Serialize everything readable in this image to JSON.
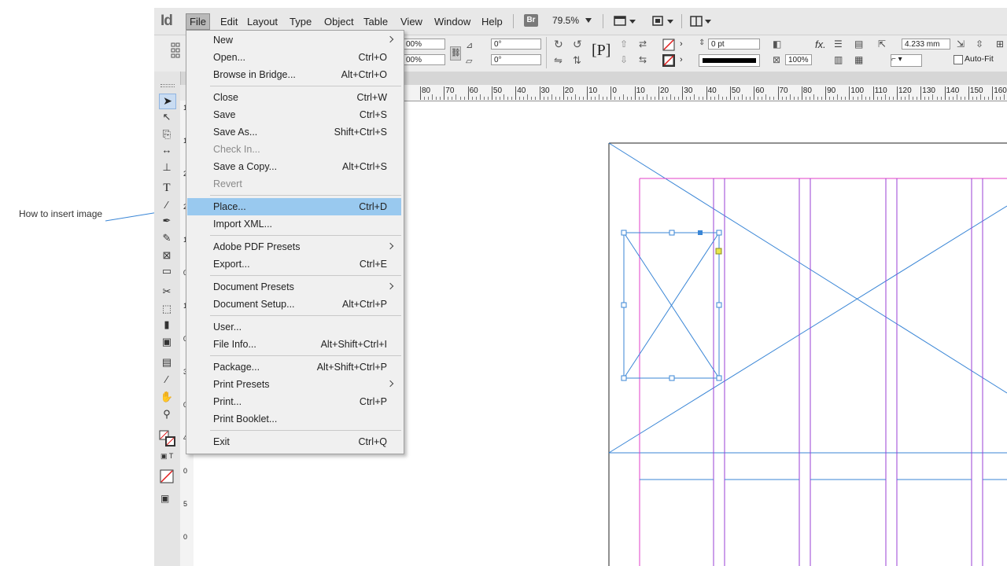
{
  "annotation": {
    "text": "How to insert image"
  },
  "app": {
    "logo": "Id",
    "menu": [
      "File",
      "Edit",
      "Layout",
      "Type",
      "Object",
      "Table",
      "View",
      "Window",
      "Help"
    ],
    "bridge": "Br",
    "zoom": "79.5%"
  },
  "controlbar": {
    "percent1": "00%",
    "percent2": "00%",
    "angle1": "0°",
    "angle2": "0°",
    "stroke_weight": "0 pt",
    "value_mm": "4.233 mm",
    "percent3": "100%",
    "autofit": "Auto-Fit"
  },
  "ruler": {
    "labels": [
      "80",
      "70",
      "60",
      "50",
      "40",
      "30",
      "20",
      "10",
      "0",
      "10",
      "20",
      "30",
      "40",
      "50",
      "60",
      "70",
      "80",
      "90",
      "100",
      "110",
      "120",
      "130",
      "140",
      "150",
      "160"
    ],
    "vlabels": [
      "1",
      "1",
      "2",
      "2",
      "1",
      "0",
      "1",
      "0",
      "3",
      "0",
      "4",
      "0",
      "5",
      "0"
    ]
  },
  "file_menu": {
    "items": [
      {
        "label": "New",
        "shortcut": "",
        "submenu": true,
        "disabled": false
      },
      {
        "label": "Open...",
        "shortcut": "Ctrl+O",
        "submenu": false,
        "disabled": false
      },
      {
        "label": "Browse in Bridge...",
        "shortcut": "Alt+Ctrl+O",
        "submenu": false,
        "disabled": false
      },
      {
        "label": "Close",
        "shortcut": "Ctrl+W",
        "submenu": false,
        "disabled": false
      },
      {
        "label": "Save",
        "shortcut": "Ctrl+S",
        "submenu": false,
        "disabled": false
      },
      {
        "label": "Save As...",
        "shortcut": "Shift+Ctrl+S",
        "submenu": false,
        "disabled": false
      },
      {
        "label": "Check In...",
        "shortcut": "",
        "submenu": false,
        "disabled": true
      },
      {
        "label": "Save a Copy...",
        "shortcut": "Alt+Ctrl+S",
        "submenu": false,
        "disabled": false
      },
      {
        "label": "Revert",
        "shortcut": "",
        "submenu": false,
        "disabled": true
      },
      {
        "label": "Place...",
        "shortcut": "Ctrl+D",
        "submenu": false,
        "disabled": false,
        "highlighted": true
      },
      {
        "label": "Import XML...",
        "shortcut": "",
        "submenu": false,
        "disabled": false
      },
      {
        "label": "Adobe PDF Presets",
        "shortcut": "",
        "submenu": true,
        "disabled": false
      },
      {
        "label": "Export...",
        "shortcut": "Ctrl+E",
        "submenu": false,
        "disabled": false
      },
      {
        "label": "Document Presets",
        "shortcut": "",
        "submenu": true,
        "disabled": false
      },
      {
        "label": "Document Setup...",
        "shortcut": "Alt+Ctrl+P",
        "submenu": false,
        "disabled": false
      },
      {
        "label": "User...",
        "shortcut": "",
        "submenu": false,
        "disabled": false
      },
      {
        "label": "File Info...",
        "shortcut": "Alt+Shift+Ctrl+I",
        "submenu": false,
        "disabled": false
      },
      {
        "label": "Package...",
        "shortcut": "Alt+Shift+Ctrl+P",
        "submenu": false,
        "disabled": false
      },
      {
        "label": "Print Presets",
        "shortcut": "",
        "submenu": true,
        "disabled": false
      },
      {
        "label": "Print...",
        "shortcut": "Ctrl+P",
        "submenu": false,
        "disabled": false
      },
      {
        "label": "Print Booklet...",
        "shortcut": "",
        "submenu": false,
        "disabled": false
      },
      {
        "label": "Exit",
        "shortcut": "Ctrl+Q",
        "submenu": false,
        "disabled": false
      }
    ]
  },
  "colors": {
    "highlight": "#99c9ef",
    "guide_purple": "#9a3fd6",
    "guide_magenta": "#e23fc9",
    "frame_blue": "#3a86d6"
  }
}
